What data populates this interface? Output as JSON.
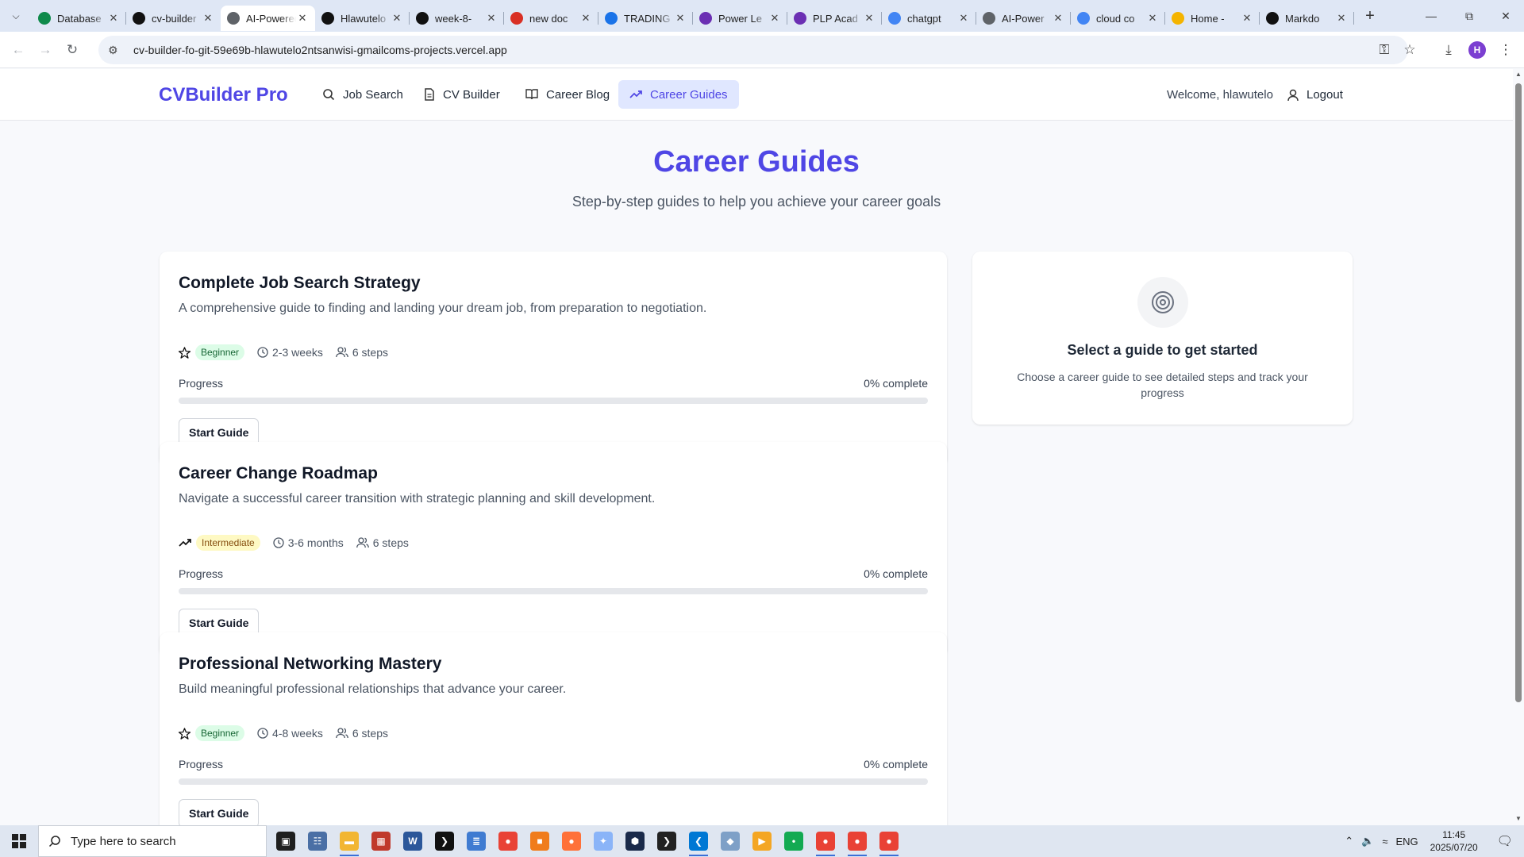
{
  "browser": {
    "tabs": [
      {
        "label": "Database",
        "icon": "database-favicon",
        "color": "#0f8a4b",
        "active": false
      },
      {
        "label": "cv-builder",
        "icon": "vercel-favicon",
        "color": "#111111",
        "active": false
      },
      {
        "label": "AI-Powered",
        "icon": "globe-favicon",
        "color": "#5f6368",
        "active": true
      },
      {
        "label": "Hlawutelo",
        "icon": "github-favicon",
        "color": "#111111",
        "active": false
      },
      {
        "label": "week-8-",
        "icon": "github-favicon",
        "color": "#111111",
        "active": false
      },
      {
        "label": "new doc",
        "icon": "gmail-favicon",
        "color": "#d93025",
        "active": false
      },
      {
        "label": "TRADING",
        "icon": "docs-favicon",
        "color": "#1a73e8",
        "active": false
      },
      {
        "label": "Power Le",
        "icon": "plp-favicon",
        "color": "#6b2fb3",
        "active": false
      },
      {
        "label": "PLP Acad",
        "icon": "plp-favicon",
        "color": "#6b2fb3",
        "active": false
      },
      {
        "label": "chatgpt",
        "icon": "google-favicon",
        "color": "#4285f4",
        "active": false
      },
      {
        "label": "AI-Power",
        "icon": "globe-favicon",
        "color": "#5f6368",
        "active": false
      },
      {
        "label": "cloud co",
        "icon": "google-favicon",
        "color": "#4285f4",
        "active": false
      },
      {
        "label": "Home -",
        "icon": "drive-favicon",
        "color": "#f4b400",
        "active": false
      },
      {
        "label": "Markdo",
        "icon": "openai-favicon",
        "color": "#111111",
        "active": false
      }
    ],
    "url": "cv-builder-fo-git-59e69b-hlawutelo2ntsanwisi-gmailcoms-projects.vercel.app",
    "profile_initial": "H"
  },
  "header": {
    "brand": "CVBuilder Pro",
    "nav": [
      {
        "label": "Job Search",
        "icon": "search-icon",
        "active": false
      },
      {
        "label": "CV Builder",
        "icon": "document-icon",
        "active": false
      },
      {
        "label": "Career Blog",
        "icon": "book-icon",
        "active": false
      },
      {
        "label": "Career Guides",
        "icon": "trending-up-icon",
        "active": true
      }
    ],
    "welcome": "Welcome, hlawutelo",
    "logout": "Logout"
  },
  "hero": {
    "title": "Career Guides",
    "subtitle": "Step-by-step guides to help you achieve your career goals"
  },
  "guides": [
    {
      "title": "Complete Job Search Strategy",
      "description": "A comprehensive guide to finding and landing your dream job, from preparation to negotiation.",
      "level_icon": "star-icon",
      "level": "Beginner",
      "duration": "2-3 weeks",
      "steps": "6 steps",
      "progress_label": "Progress",
      "progress_text": "0% complete",
      "progress": 0,
      "button": "Start Guide"
    },
    {
      "title": "Career Change Roadmap",
      "description": "Navigate a successful career transition with strategic planning and skill development.",
      "level_icon": "trending-up-icon",
      "level": "Intermediate",
      "duration": "3-6 months",
      "steps": "6 steps",
      "progress_label": "Progress",
      "progress_text": "0% complete",
      "progress": 0,
      "button": "Start Guide"
    },
    {
      "title": "Professional Networking Mastery",
      "description": "Build meaningful professional relationships that advance your career.",
      "level_icon": "star-icon",
      "level": "Beginner",
      "duration": "4-8 weeks",
      "steps": "6 steps",
      "progress_label": "Progress",
      "progress_text": "0% complete",
      "progress": 0,
      "button": "Start Guide"
    }
  ],
  "sidebar": {
    "icon": "target-icon",
    "title": "Select a guide to get started",
    "description": "Choose a career guide to see detailed steps and track your progress"
  },
  "taskbar": {
    "search_placeholder": "Type here to search",
    "time": "11:45",
    "date": "2025/07/20",
    "language": "ENG"
  },
  "colors": {
    "accent": "#4f46e5",
    "beginner_bg": "#dcfce7",
    "intermediate_bg": "#fef9c3"
  }
}
